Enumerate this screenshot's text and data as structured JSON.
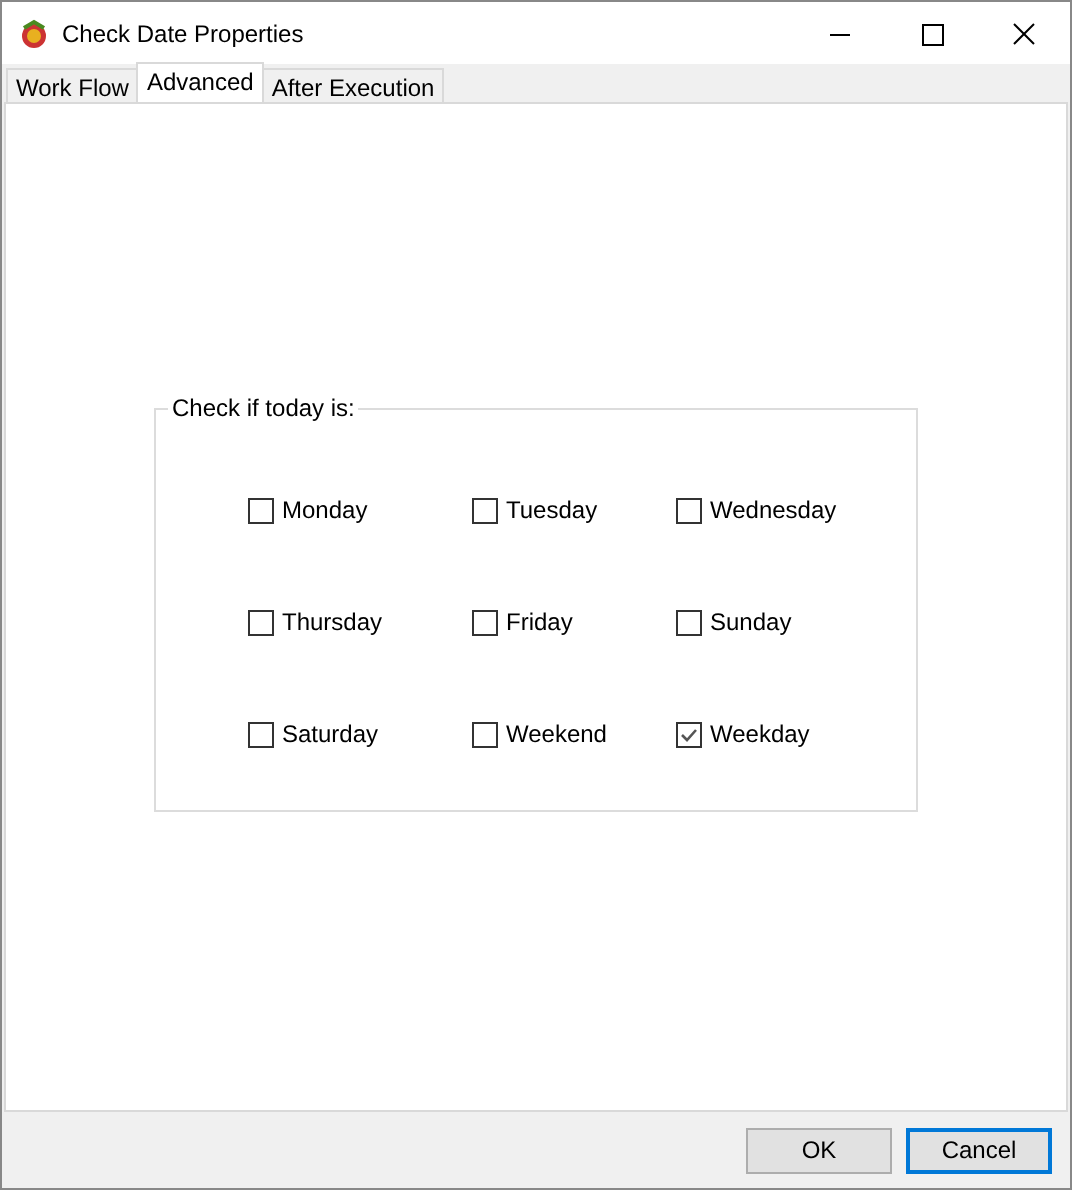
{
  "window": {
    "title": "Check Date Properties"
  },
  "tabs": [
    {
      "label": "Work Flow",
      "selected": false
    },
    {
      "label": "Advanced",
      "selected": true
    },
    {
      "label": "After Execution",
      "selected": false
    }
  ],
  "group": {
    "title": "Check if today is:",
    "options": [
      {
        "label": "Monday",
        "checked": false
      },
      {
        "label": "Tuesday",
        "checked": false
      },
      {
        "label": "Wednesday",
        "checked": false
      },
      {
        "label": "Thursday",
        "checked": false
      },
      {
        "label": "Friday",
        "checked": false
      },
      {
        "label": "Sunday",
        "checked": false
      },
      {
        "label": "Saturday",
        "checked": false
      },
      {
        "label": "Weekend",
        "checked": false
      },
      {
        "label": "Weekday",
        "checked": true
      }
    ]
  },
  "buttons": [
    {
      "label": "OK",
      "kind": "normal"
    },
    {
      "label": "Cancel",
      "kind": "default"
    }
  ]
}
